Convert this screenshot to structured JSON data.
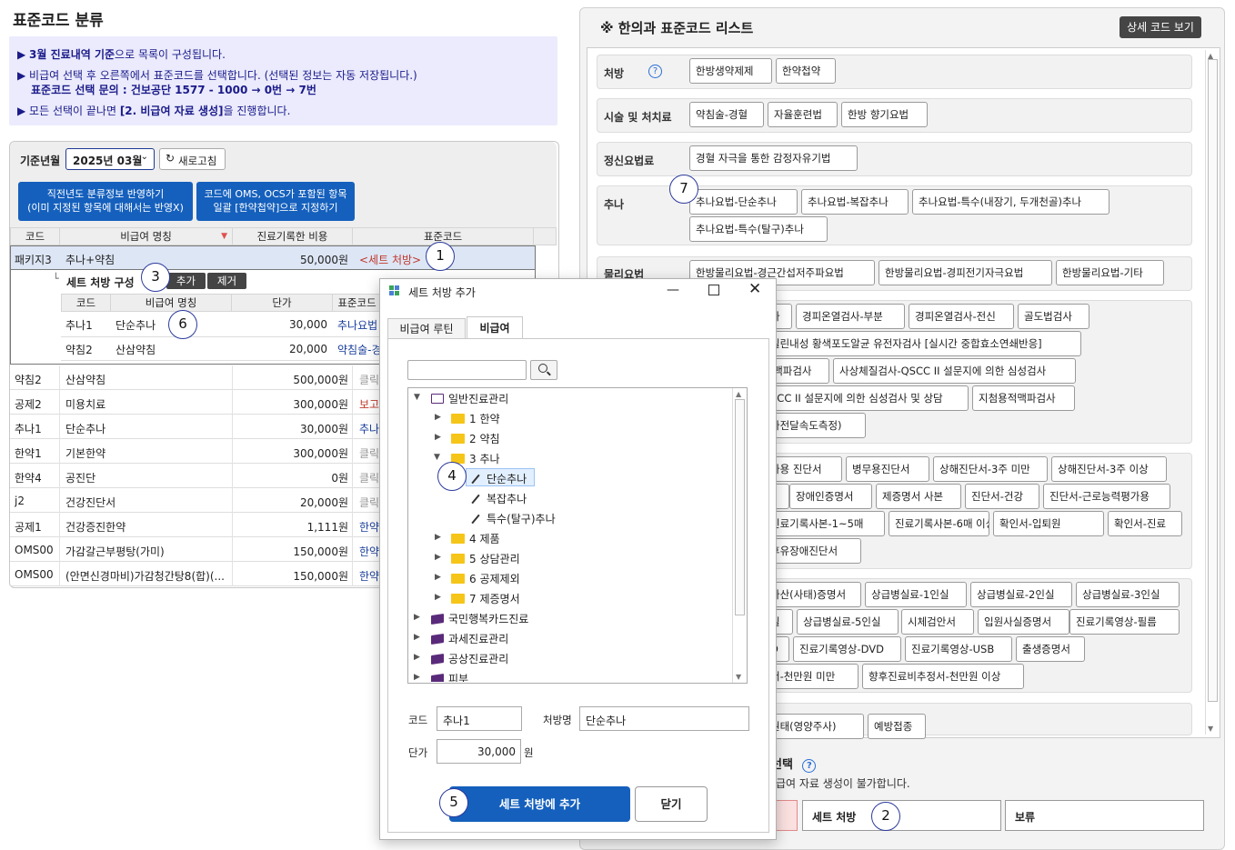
{
  "page_title": "표준코드 분류",
  "info": {
    "line1_bold": "3월 진료내역 기준",
    "line1_rest": "으로 목록이 구성됩니다.",
    "line2": "비급여 선택 후 오른쪽에서 표준코드를 선택합니다. (선택된 정보는 자동 저장됩니다.)",
    "line3": "표준코드 선택 문의 : 건보공단 1577 - 1000 → 0번 → 7번",
    "line4_pre": "모든 선택이 끝나면 ",
    "line4_bold": "[2. 비급여 자료 생성]",
    "line4_post": "을 진행합니다."
  },
  "left": {
    "base_label": "기준년월",
    "base_value": "2025년 03월",
    "refresh_label": "새로고침",
    "btn_apply_prev": "직전년도 분류정보 반영하기",
    "btn_apply_prev_sub": "(이미 지정된 항목에 대해서는 반영X)",
    "btn_oms": "코드에 OMS, OCS가 포함된 항목",
    "btn_oms_sub": "일괄 [한약첩약]으로 지정하기",
    "columns": [
      "코드",
      "비급여 명칭",
      "진료기록한 비용",
      "표준코드"
    ],
    "selected_row": {
      "code": "패키지3",
      "name": "추나+약침",
      "cost": "50,000원",
      "std": "<세트 처방>"
    },
    "set_panel": {
      "title": "세트 처방 구성",
      "add": "추가",
      "remove": "제거",
      "columns": [
        "코드",
        "비급여 명칭",
        "단가",
        "표준코드"
      ],
      "rows": [
        {
          "code": "추나1",
          "name": "단순추나",
          "price": "30,000",
          "std": "추나요법"
        },
        {
          "code": "약침2",
          "name": "산삼약침",
          "price": "20,000",
          "std": "약침술-경"
        }
      ]
    },
    "rows": [
      {
        "code": "약침2",
        "name": "산삼약침",
        "cost": "500,000원",
        "std": "클릭"
      },
      {
        "code": "공제2",
        "name": "미용치료",
        "cost": "300,000원",
        "std": "보고"
      },
      {
        "code": "추나1",
        "name": "단순추나",
        "cost": "30,000원",
        "std": "추나"
      },
      {
        "code": "한약1",
        "name": "기본한약",
        "cost": "300,000원",
        "std": "클릭"
      },
      {
        "code": "한약4",
        "name": "공진단",
        "cost": "0원",
        "std": "클릭"
      },
      {
        "code": "j2",
        "name": "건강진단서",
        "cost": "20,000원",
        "std": "클릭"
      },
      {
        "code": "공제1",
        "name": "건강증진한약",
        "cost": "1,111원",
        "std": "한약"
      },
      {
        "code": "OMS00",
        "name": "가감갈근부평탕(가미)",
        "cost": "150,000원",
        "std": "한약"
      },
      {
        "code": "OMS00",
        "name": "(안면신경마비)가감청간탕8(합)(...",
        "cost": "150,000원",
        "std": "한약"
      }
    ]
  },
  "right": {
    "title": "※ 한의과 표준코드 리스트",
    "detail_button": "상세 코드 보기",
    "categories": [
      {
        "label": "처방",
        "items": [
          "한방생약제제",
          "한약첩약"
        ]
      },
      {
        "label": "시술 및 처치료",
        "items": [
          "약침술-경혈",
          "자율훈련법",
          "한방 향기요법"
        ]
      },
      {
        "label": "정신요법료",
        "items": [
          "경혈 자극을 통한 감정자유기법"
        ]
      },
      {
        "label": "추나",
        "items": [
          "추나요법-단순추나",
          "추나요법-복잡추나",
          "추나요법-특수(내장기, 두개천골)추나",
          "추나요법-특수(탈구)추나"
        ]
      },
      {
        "label": "물리요법",
        "items": [
          "한방물리요법-경근간섭저주파요법",
          "한방물리요법-경피전기자극요법",
          "한방물리요법-기타"
        ]
      }
    ],
    "exam_items": [
      "사",
      "경피온열검사-부분",
      "경피온열검사-전신",
      "골도법검사",
      "실린내성 황색포도알균 유전자검사 [실시간 중합효소연쇄반응]",
      "l맥파검사",
      "사상체질검사-QSCC II 설문지에 의한 심성검사",
      "SCC II 설문지에 의한 심성검사 및 상담",
      "지첨용적맥파검사",
      "파전달속도측정)"
    ],
    "cert_items": [
      "사용 진단서",
      "병무용진단서",
      "상해진단서-3주 미만",
      "상해진단서-3주 이상",
      "장애인증명서",
      "제증명서 사본",
      "진단서-건강",
      "진단서-근로능력평가용",
      "진료기록사본-1~5매",
      "진료기록사본-6매 이상",
      "확인서-입퇴원",
      "확인서-진료",
      "후유장애진단서"
    ],
    "record_items": [
      "사산(사태)증명서",
      "상급병실료-1인실",
      "상급병실료-2인실",
      "상급병실료-3인실",
      "실",
      "상급병실료-5인실",
      "시체검안서",
      "입원사실증명서",
      "진료기록영상-필름",
      "D",
      "진료기록영상-DVD",
      "진료기록영상-USB",
      "출생증명서",
      "서-천만원 미만",
      "향후진료비추정서-천만원 이상"
    ],
    "vacc_items": [
      "권태(영양주사)",
      "예방접종"
    ],
    "bottom_title": "선택",
    "bottom_note": "급여 자료 생성이 불가합니다.",
    "bottom_btn_set": "세트 처방",
    "bottom_btn_hold": "보류"
  },
  "dialog": {
    "title": "세트 처방 추가",
    "tab1": "비급여 루틴",
    "tab2": "비급여",
    "search_placeholder": "",
    "tree": {
      "root": "일반진료관리",
      "children": [
        "1 한약",
        "2 약침",
        "3 추나",
        "단순추나",
        "복잡추나",
        "특수(탈구)추나",
        "4 제품",
        "5 상담관리",
        "6 공제제외",
        "7 제증명서"
      ],
      "other_roots": [
        "국민행복카드진료",
        "과세진료관리",
        "공상진료관리",
        "피부"
      ]
    },
    "code_label": "코드",
    "code_value": "추나1",
    "name_label": "처방명",
    "name_value": "단순추나",
    "price_label": "단가",
    "price_value": "30,000",
    "price_unit": "원",
    "add_button": "세트 처방에 추가",
    "close_button": "닫기"
  },
  "markers": [
    "1",
    "2",
    "3",
    "4",
    "5",
    "6",
    "7"
  ]
}
